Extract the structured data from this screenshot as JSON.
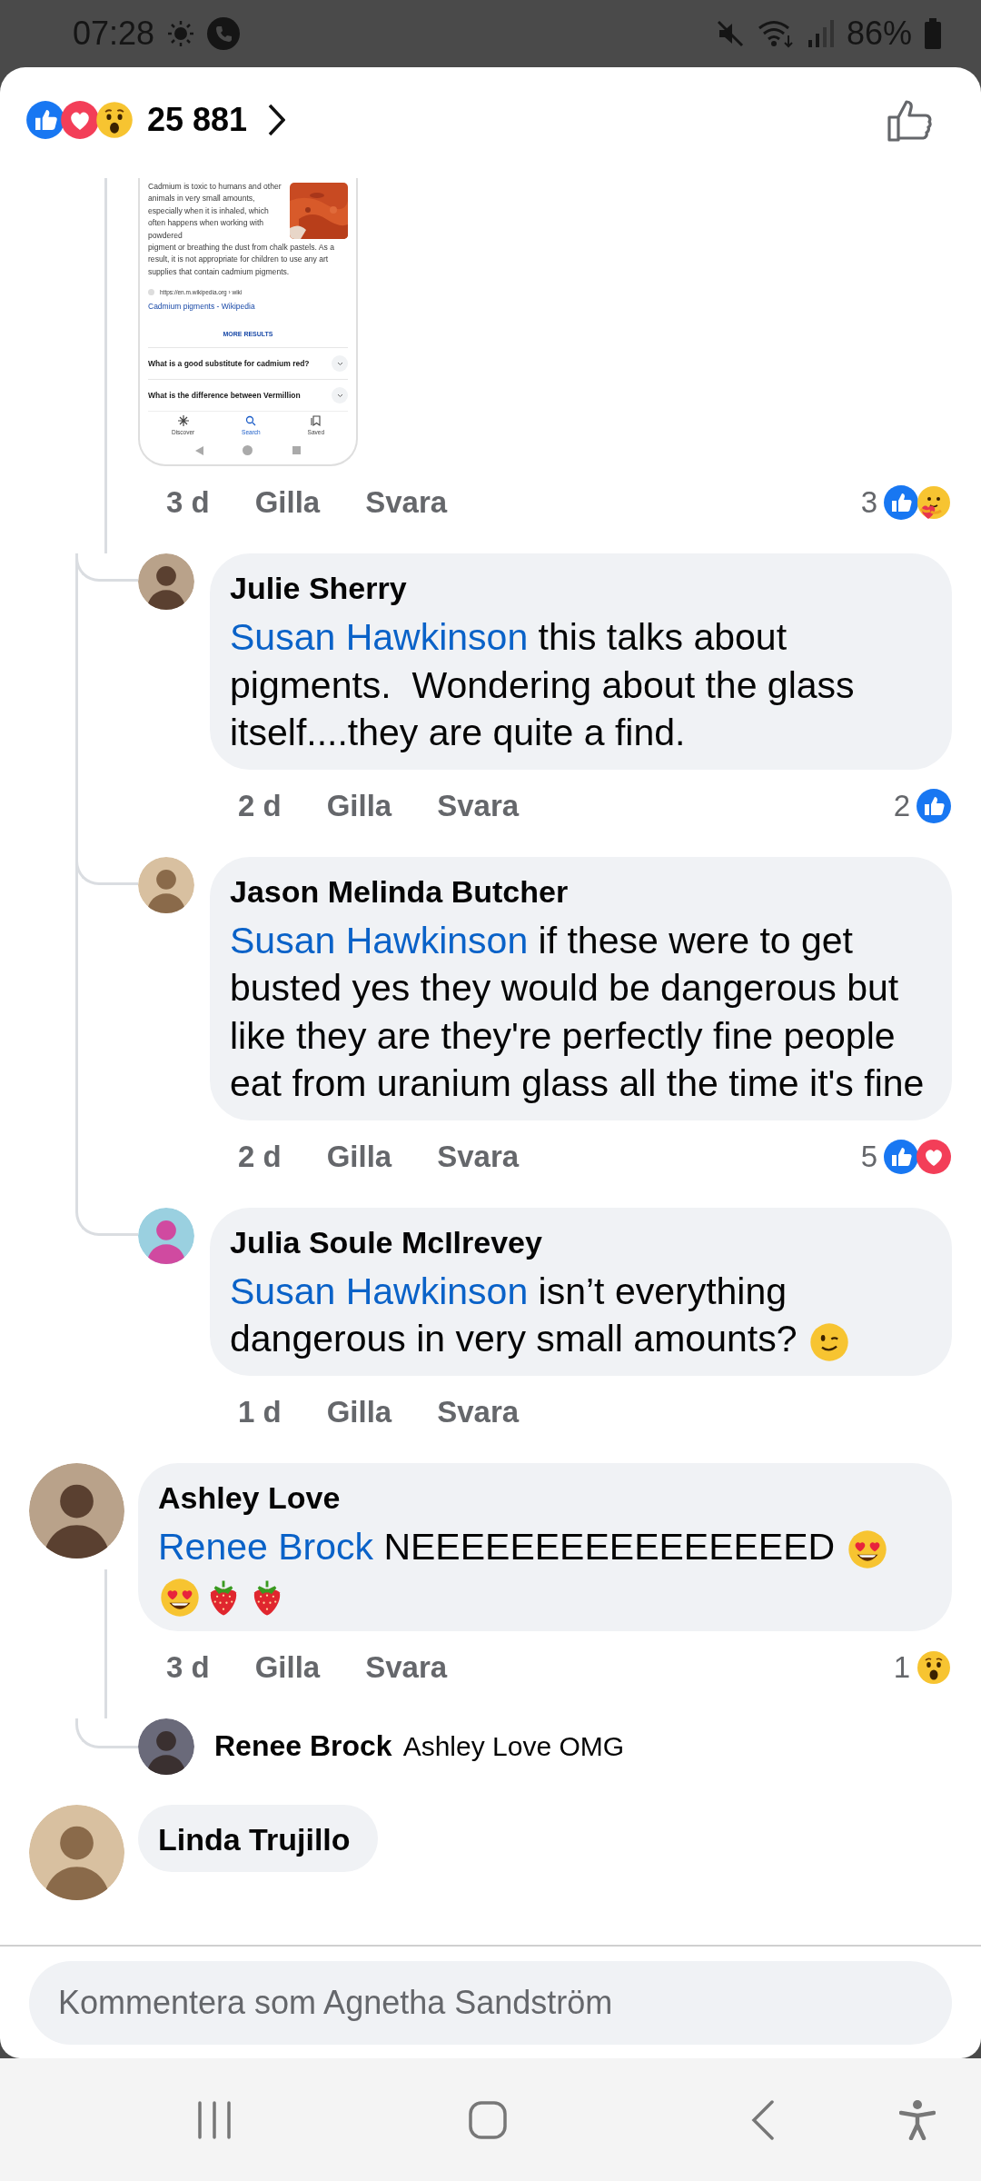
{
  "status_bar": {
    "time": "07:28",
    "battery": "86%"
  },
  "header": {
    "reactions": [
      {
        "kind": "like"
      },
      {
        "kind": "love"
      },
      {
        "kind": "wow"
      }
    ],
    "count": "25 881"
  },
  "comments": [
    {
      "kind": "attachment",
      "attachment": {
        "intro": "Cadmium is toxic to humans and other animals in very small amounts, especially when it is inhaled, which often happens when working with powdered",
        "paragraph": "pigment or breathing the dust from chalk pastels. As a result, it is not appropriate for children to use any art supplies that contain cadmium pigments.",
        "source": "https://en.m.wikipedia.org › wiki",
        "link": "Cadmium pigments - Wikipedia",
        "more": "MORE RESULTS",
        "questions": [
          "What is a good substitute for cadmium red?",
          "What is the difference between Vermillion"
        ],
        "tabs": [
          {
            "label": "Discover",
            "kind": "discover",
            "selected": false
          },
          {
            "label": "Search",
            "kind": "search",
            "selected": true
          },
          {
            "label": "Saved",
            "kind": "saved",
            "selected": false
          }
        ]
      },
      "time": "3 d",
      "like_label": "Gilla",
      "reply_label": "Svara",
      "reaction_count": "3",
      "reactions": [
        {
          "kind": "like"
        },
        {
          "kind": "care"
        }
      ],
      "replies": [
        {
          "kind": "bubble",
          "author": "Julie Sherry",
          "mention": "Susan Hawkinson",
          "text": "this talks about pigments.  Wondering about the glass itself....they are quite a find.",
          "time": "2 d",
          "like_label": "Gilla",
          "reply_label": "Svara",
          "reaction_count": "2",
          "reactions": [
            {
              "kind": "like"
            }
          ]
        },
        {
          "kind": "bubble",
          "author": "Jason Melinda Butcher",
          "mention": "Susan Hawkinson",
          "text": "if these were to get busted yes they would be dangerous but like they are they're perfectly fine people eat from uranium glass all the time it's fine",
          "time": "2 d",
          "like_label": "Gilla",
          "reply_label": "Svara",
          "reaction_count": "5",
          "reactions": [
            {
              "kind": "like"
            },
            {
              "kind": "love"
            }
          ]
        },
        {
          "kind": "bubble",
          "author": "Julia Soule McIlrevey",
          "mention": "Susan Hawkinson",
          "text": "isn’t everything dangerous in very small amounts?",
          "emoji": [
            {
              "kind": "wink"
            }
          ],
          "time": "1 d",
          "like_label": "Gilla",
          "reply_label": "Svara"
        }
      ]
    },
    {
      "kind": "bubble",
      "author": "Ashley Love",
      "mention": "Renee Brock",
      "text": "NEEEEEEEEEEEEEEEED",
      "emoji": [
        {
          "kind": "heart_eyes"
        },
        {
          "kind": "heart_eyes"
        },
        {
          "kind": "strawberry"
        },
        {
          "kind": "strawberry"
        }
      ],
      "time": "3 d",
      "like_label": "Gilla",
      "reply_label": "Svara",
      "reaction_count": "1",
      "reactions": [
        {
          "kind": "wow"
        }
      ],
      "replies": [
        {
          "kind": "compact",
          "author": "Renee Brock",
          "text": "Ashley Love OMG"
        }
      ]
    },
    {
      "kind": "bubble",
      "author": "Linda Trujillo"
    }
  ],
  "composer": {
    "placeholder": "Kommentera som Agnetha Sandström"
  }
}
